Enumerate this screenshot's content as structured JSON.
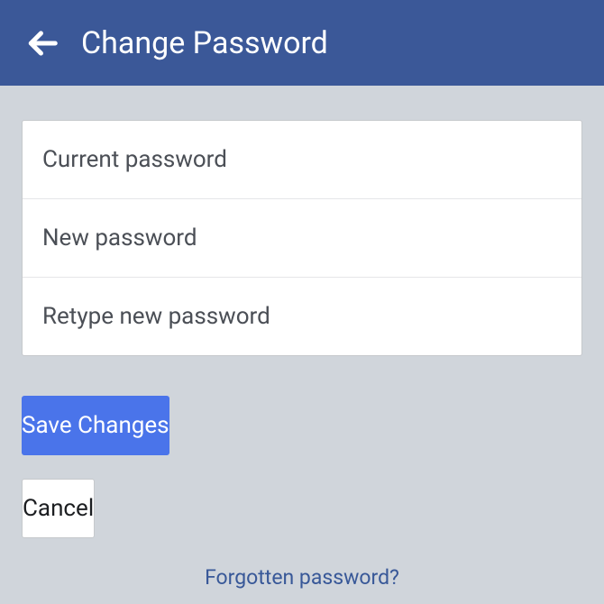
{
  "header": {
    "title": "Change Password"
  },
  "fields": {
    "current": {
      "placeholder": "Current password"
    },
    "new": {
      "placeholder": "New password"
    },
    "retype": {
      "placeholder": "Retype new password"
    }
  },
  "buttons": {
    "save": "Save Changes",
    "cancel": "Cancel"
  },
  "links": {
    "forgot": "Forgotten password?"
  }
}
